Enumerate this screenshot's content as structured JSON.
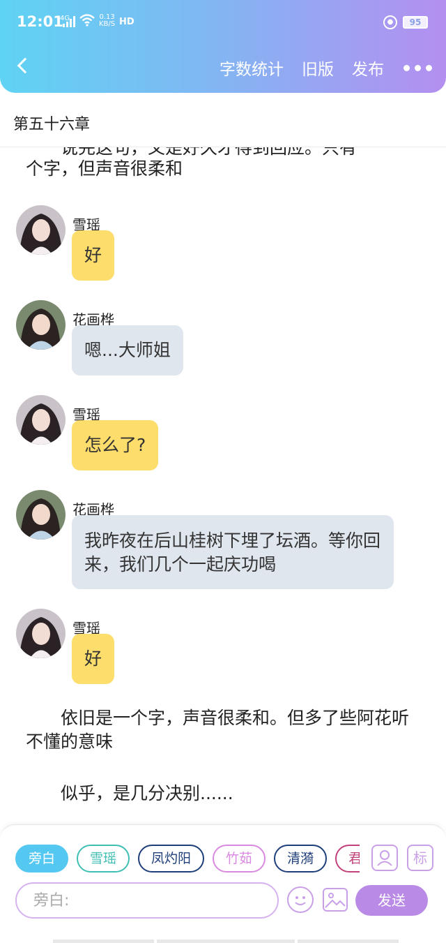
{
  "status_bar": {
    "time": "12:01",
    "network": "4G",
    "speed_value": "0.13",
    "speed_unit": "KB/S",
    "hd": "HD",
    "battery": "95"
  },
  "header": {
    "actions": [
      "字数统计",
      "旧版",
      "发布"
    ]
  },
  "chapter": {
    "title": "第五十六章"
  },
  "content": {
    "top_paragraph_partial": "说完这句，又是好久才得到回应。只有",
    "top_paragraph_line": "个字，但声音很柔和",
    "messages": [
      {
        "name": "雪瑶",
        "text": "好",
        "style": "yellow"
      },
      {
        "name": "花画桦",
        "text": "嗯...大师姐",
        "style": "gray"
      },
      {
        "name": "雪瑶",
        "text": "怎么了?",
        "style": "yellow"
      },
      {
        "name": "花画桦",
        "text": "我昨夜在后山桂树下埋了坛酒。等你回来，我们几个一起庆功喝",
        "style": "gray"
      },
      {
        "name": "雪瑶",
        "text": "好",
        "style": "yellow"
      }
    ],
    "paragraph_2": "依旧是一个字，声音很柔和。但多了些阿花听不懂的意味",
    "paragraph_3": "似乎，是几分决别......"
  },
  "composer": {
    "roles": [
      {
        "label": "旁白",
        "color": "#55c8f2",
        "active": true
      },
      {
        "label": "雪瑶",
        "color": "#3fbfb4",
        "active": false
      },
      {
        "label": "凤灼阳",
        "color": "#1f3f7a",
        "active": false
      },
      {
        "label": "竹茹",
        "color": "#d98ae0",
        "active": false
      },
      {
        "label": "清漪",
        "color": "#1f3f7a",
        "active": false
      },
      {
        "label": "君",
        "color": "#c2417a",
        "active": false
      }
    ],
    "mark_label": "标",
    "input_placeholder": "旁白:",
    "send_label": "发送"
  }
}
